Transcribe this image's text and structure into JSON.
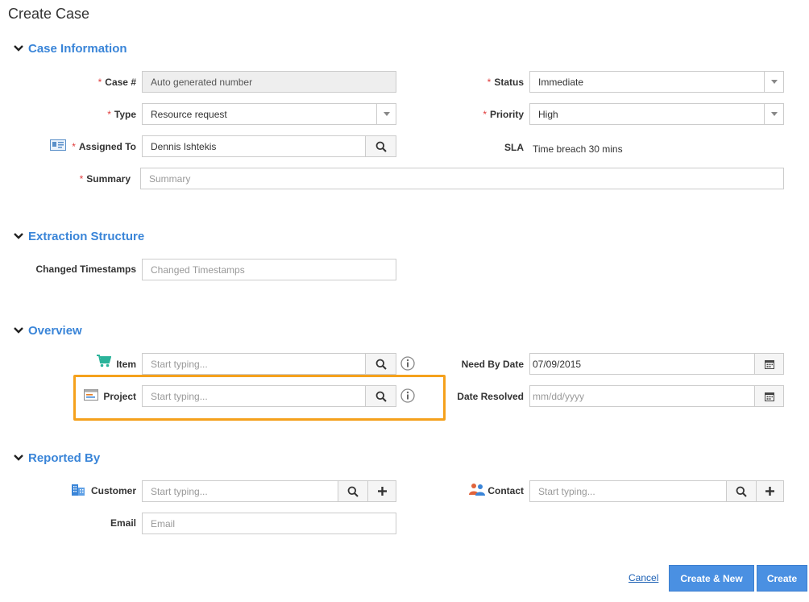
{
  "page": {
    "title": "Create Case"
  },
  "sections": {
    "case_info": "Case Information",
    "extraction": "Extraction Structure",
    "overview": "Overview",
    "reported_by": "Reported By"
  },
  "required_mark": "*",
  "case_info": {
    "case_no_label": "Case #",
    "case_no_value": "Auto generated number",
    "type_label": "Type",
    "type_value": "Resource request",
    "assigned_label": "Assigned To",
    "assigned_value": "Dennis Ishtekis",
    "summary_label": "Summary",
    "summary_placeholder": "Summary",
    "status_label": "Status",
    "status_value": "Immediate",
    "priority_label": "Priority",
    "priority_value": "High",
    "sla_label": "SLA",
    "sla_value": "Time breach 30 mins"
  },
  "extraction": {
    "changed_ts_label": "Changed Timestamps",
    "changed_ts_placeholder": "Changed Timestamps"
  },
  "overview": {
    "item_label": "Item",
    "item_placeholder": "Start typing...",
    "project_label": "Project",
    "project_placeholder": "Start typing...",
    "need_by_label": "Need By Date",
    "need_by_value": "07/09/2015",
    "resolved_label": "Date Resolved",
    "resolved_placeholder": "mm/dd/yyyy"
  },
  "reported_by": {
    "customer_label": "Customer",
    "customer_placeholder": "Start typing...",
    "email_label": "Email",
    "email_placeholder": "Email",
    "contact_label": "Contact",
    "contact_placeholder": "Start typing..."
  },
  "footer": {
    "cancel": "Cancel",
    "create_new": "Create & New",
    "create": "Create"
  },
  "colors": {
    "accent": "#3a85d8",
    "required": "#e03b3b",
    "highlight": "#f5a11c",
    "button": "#4a90e2"
  },
  "icons": [
    "chevron-down-icon",
    "contact-card-icon",
    "search-icon",
    "cart-icon",
    "project-icon",
    "info-icon",
    "calendar-icon",
    "building-icon",
    "people-icon",
    "plus-icon"
  ]
}
